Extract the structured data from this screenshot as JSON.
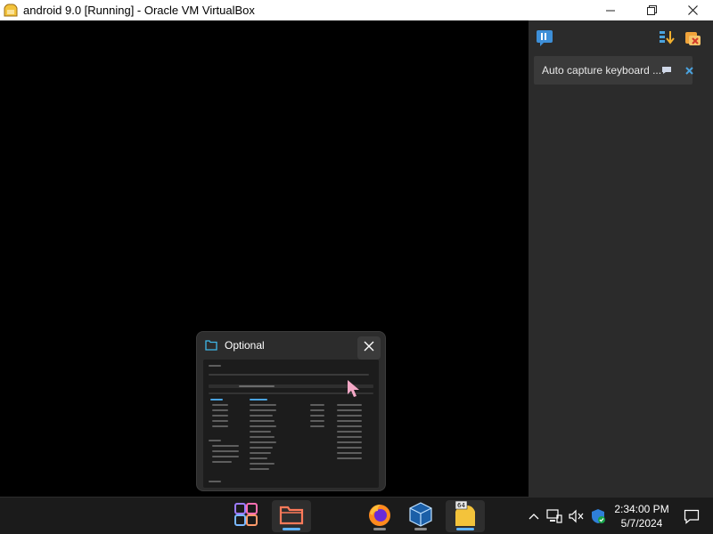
{
  "window": {
    "title": "android 9.0 [Running] - Oracle VM VirtualBox",
    "icon": "virtualbox-vm-icon"
  },
  "window_controls": {
    "minimize": "minimize-icon",
    "maximize": "restore-icon",
    "close": "close-icon"
  },
  "side_panel": {
    "top_left_icon": "message-log-icon",
    "top_right_icons": [
      "sort-download-icon",
      "clear-notifications-icon"
    ],
    "notification": {
      "text": "Auto capture keyboard ...",
      "actions": [
        "details-icon",
        "dismiss-icon"
      ]
    }
  },
  "thumbnail_popup": {
    "title": "Optional",
    "icon": "folder-icon",
    "close_icon": "close-icon",
    "preview": "file-explorer-window-preview"
  },
  "taskbar": {
    "apps": [
      {
        "name": "start",
        "icon": "windows-start-icon",
        "active": false
      },
      {
        "name": "file-explorer",
        "icon": "file-explorer-icon",
        "active": true
      },
      {
        "name": "firefox",
        "icon": "firefox-icon",
        "active": false
      },
      {
        "name": "virtualbox",
        "icon": "virtualbox-icon",
        "active": false
      },
      {
        "name": "virtualbox-vm",
        "icon": "virtualbox-vm-icon",
        "active": true,
        "badge": "64"
      }
    ],
    "tray": [
      "chevron-up-icon",
      "network-icon",
      "volume-muted-icon",
      "windows-security-icon"
    ],
    "clock": {
      "time": "2:34:00 PM",
      "date": "5/7/2024"
    },
    "notification_icon": "notification-center-icon"
  }
}
